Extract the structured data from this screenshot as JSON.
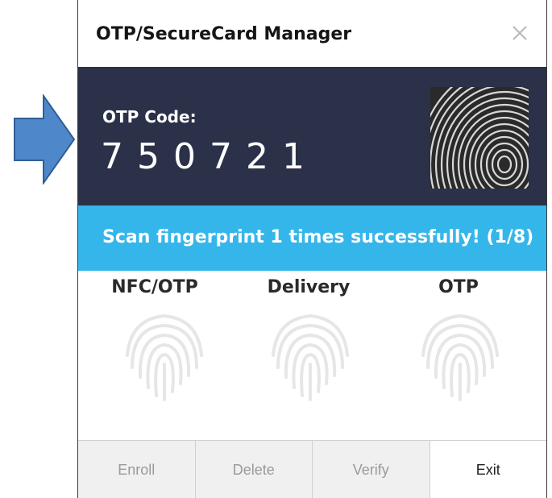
{
  "window": {
    "title": "OTP/SecureCard Manager"
  },
  "otp": {
    "label": "OTP Code:",
    "code": "750721"
  },
  "status": {
    "message": "Scan fingerprint 1 times successfully! (1/8)"
  },
  "slots": [
    {
      "label": "NFC/OTP"
    },
    {
      "label": "Delivery"
    },
    {
      "label": "OTP"
    }
  ],
  "buttons": {
    "enroll": "Enroll",
    "delete": "Delete",
    "verify": "Verify",
    "exit": "Exit"
  },
  "colors": {
    "otp_panel": "#2b3148",
    "status_bar": "#35b6ea",
    "arrow": "#4f87cb"
  }
}
